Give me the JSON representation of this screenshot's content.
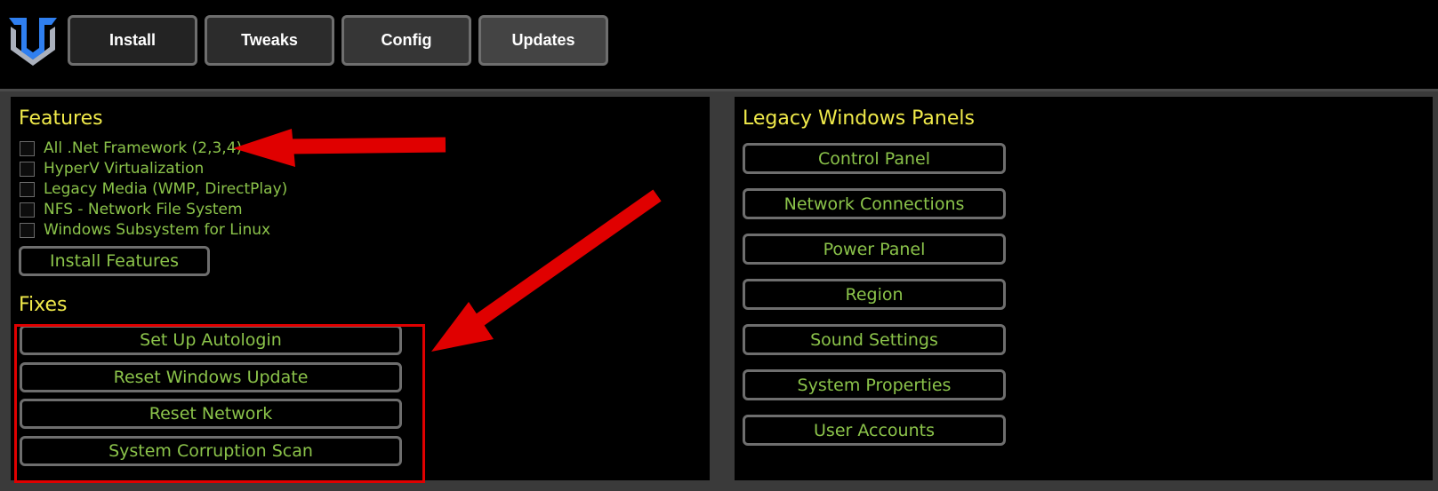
{
  "nav": {
    "tabs": [
      {
        "label": "Install"
      },
      {
        "label": "Tweaks"
      },
      {
        "label": "Config"
      },
      {
        "label": "Updates"
      }
    ]
  },
  "features": {
    "heading": "Features",
    "items": [
      {
        "label": "All .Net Framework (2,3,4)",
        "checked": false
      },
      {
        "label": "HyperV Virtualization",
        "checked": false
      },
      {
        "label": "Legacy Media (WMP, DirectPlay)",
        "checked": false
      },
      {
        "label": "NFS - Network File System",
        "checked": false
      },
      {
        "label": "Windows Subsystem for Linux",
        "checked": false
      }
    ],
    "install_button": "Install Features"
  },
  "fixes": {
    "heading": "Fixes",
    "buttons": [
      {
        "label": "Set Up Autologin"
      },
      {
        "label": "Reset Windows Update"
      },
      {
        "label": "Reset Network"
      },
      {
        "label": "System Corruption Scan"
      }
    ]
  },
  "legacy": {
    "heading": "Legacy Windows Panels",
    "buttons": [
      {
        "label": "Control Panel"
      },
      {
        "label": "Network Connections"
      },
      {
        "label": "Power Panel"
      },
      {
        "label": "Region"
      },
      {
        "label": "Sound Settings"
      },
      {
        "label": "System Properties"
      },
      {
        "label": "User Accounts"
      }
    ]
  },
  "colors": {
    "accent_text": "#8bc34a",
    "heading_text": "#f0ea4a",
    "annotation_red": "#e00000",
    "logo_blue": "#2f7ff0"
  }
}
